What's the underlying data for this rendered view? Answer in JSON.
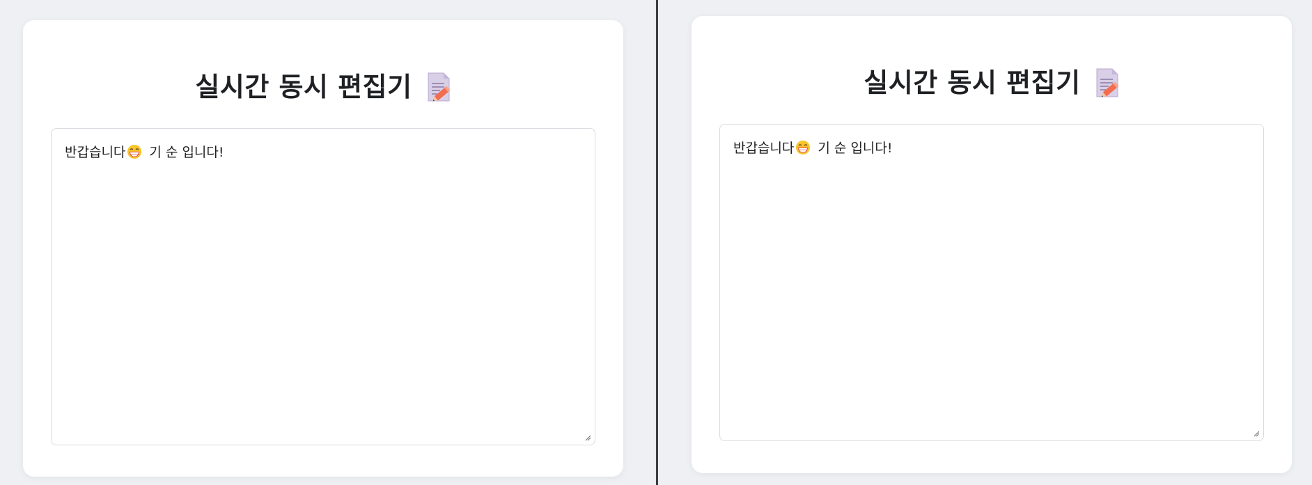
{
  "panes": [
    {
      "id": "left",
      "title": "실시간 동시 편집기",
      "title_icon": "memo-icon",
      "editor": {
        "text_before_emoji": "반갑습니다",
        "emoji": "grinning-face-with-teeth",
        "text_after_emoji": "기 순 입니다!"
      }
    },
    {
      "id": "right",
      "title": "실시간 동시 편집기",
      "title_icon": "memo-icon",
      "editor": {
        "text_before_emoji": "반갑습니다",
        "emoji": "grinning-face-with-teeth",
        "text_after_emoji": "기 순 입니다!"
      }
    }
  ],
  "colors": {
    "background": "#eef0f4",
    "card": "#ffffff",
    "title_text": "#1f2023",
    "editor_border": "#d9dbe0",
    "divider": "#3b3d42"
  }
}
